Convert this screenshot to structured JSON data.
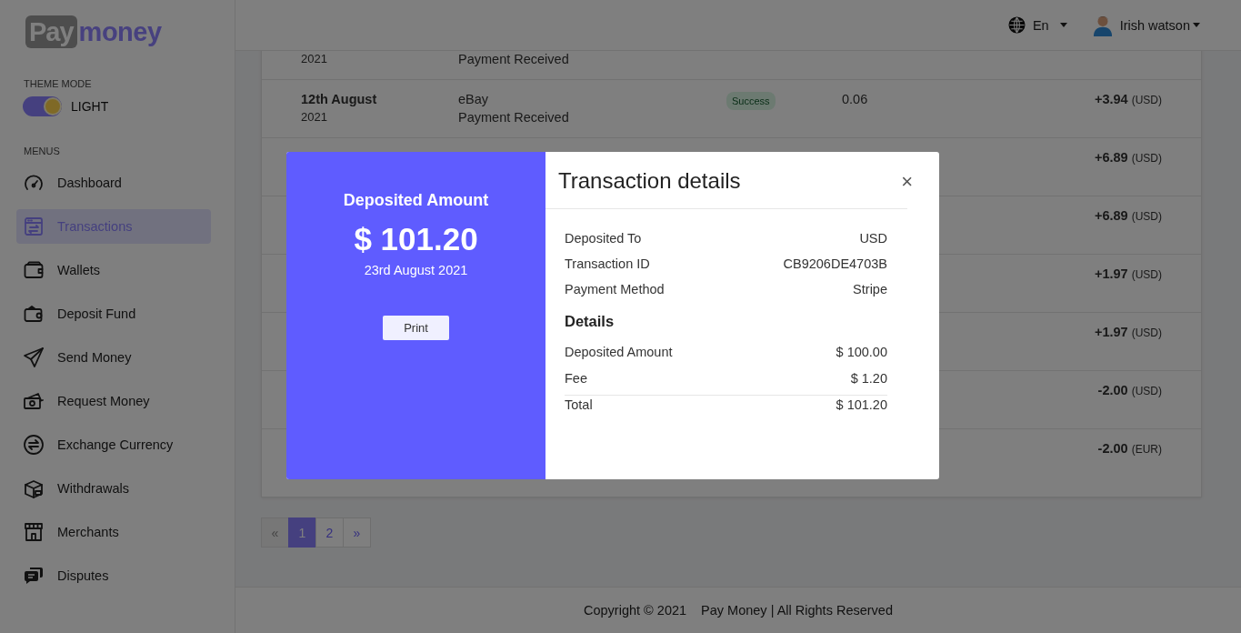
{
  "logo": {
    "badge": "Pay",
    "word": "money"
  },
  "header": {
    "language": "En",
    "user": "Irish watson"
  },
  "sidebar": {
    "theme_label": "THEME MODE",
    "theme_toggle": {
      "label": "LIGHT",
      "on": true
    },
    "menus_label": "MENUS",
    "items": [
      {
        "kind": "gauge",
        "label": "Dashboard",
        "selected": false
      },
      {
        "kind": "transfer",
        "label": "Transactions",
        "selected": true
      },
      {
        "kind": "wallet",
        "label": "Wallets",
        "selected": false
      },
      {
        "kind": "deposit",
        "label": "Deposit Fund",
        "selected": false
      },
      {
        "kind": "send",
        "label": "Send Money",
        "selected": false
      },
      {
        "kind": "cash",
        "label": "Request Money",
        "selected": false
      },
      {
        "kind": "exchange",
        "label": "Exchange Currency",
        "selected": false
      },
      {
        "kind": "box",
        "label": "Withdrawals",
        "selected": false
      },
      {
        "kind": "store",
        "label": "Merchants",
        "selected": false
      },
      {
        "kind": "chat",
        "label": "Disputes",
        "selected": false
      }
    ]
  },
  "transactions": {
    "rows": [
      {
        "year": "2021",
        "note": "Payment Received"
      },
      {
        "date": "12th August",
        "year": "2021",
        "description": "eBay",
        "note": "Payment Received",
        "status": "Success",
        "fee": "0.06",
        "amount": "+3.94",
        "currency": "(USD)"
      },
      {
        "amount": "+6.89",
        "currency": "(USD)"
      },
      {
        "amount": "+6.89",
        "currency": "(USD)"
      },
      {
        "amount": "+1.97",
        "currency": "(USD)"
      },
      {
        "amount": "+1.97",
        "currency": "(USD)"
      },
      {
        "amount": "-2.00",
        "currency": "(USD)"
      },
      {
        "amount": "-2.00",
        "currency": "(EUR)"
      }
    ]
  },
  "pagination": [
    {
      "label": "«",
      "selected": false,
      "disabled": true
    },
    {
      "label": "1",
      "selected": true,
      "disabled": false
    },
    {
      "label": "2",
      "selected": false,
      "disabled": false
    },
    {
      "label": "»",
      "selected": false,
      "disabled": false
    }
  ],
  "footer": {
    "copyright": "Copyright © 2021",
    "rights": "Pay Money | All Rights Reserved"
  },
  "modal": {
    "summary_title": "Deposited Amount",
    "total": "$ 101.20",
    "date": "23rd August 2021",
    "print": "Print",
    "title": "Transaction details",
    "close": "×",
    "info": [
      {
        "label": "Deposited To",
        "value": "USD"
      },
      {
        "label": "Transaction ID",
        "value": "CB9206DE4703B"
      },
      {
        "label": "Payment Method",
        "value": "Stripe"
      }
    ],
    "details_title": "Details",
    "details": [
      {
        "label": "Deposited Amount",
        "value": "$ 100.00",
        "divider": false
      },
      {
        "label": "Fee",
        "value": "$ 1.20",
        "divider": true
      },
      {
        "label": "Total",
        "value": "$ 101.20",
        "divider": false
      }
    ]
  }
}
